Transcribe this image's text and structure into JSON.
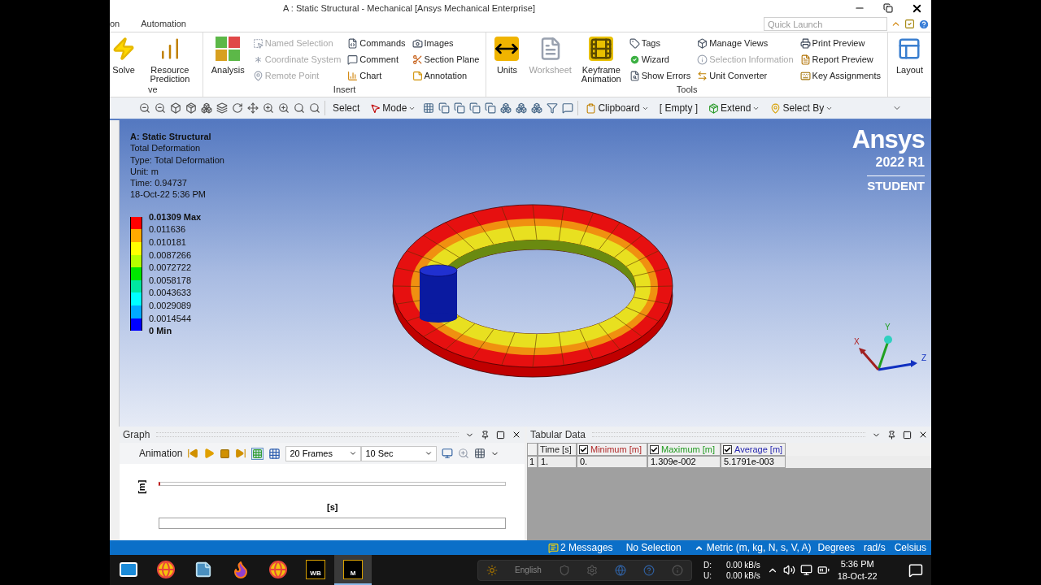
{
  "window": {
    "title": "A : Static Structural - Mechanical [Ansys Mechanical Enterprise]"
  },
  "menu_tabs": [
    "on",
    "Automation"
  ],
  "quick_launch": {
    "placeholder": "Quick Launch"
  },
  "ribbon": {
    "groups": [
      {
        "label": "ve",
        "items": [
          {
            "kind": "large",
            "label": "Solve",
            "disabled": false
          },
          {
            "kind": "large",
            "label": "Resource Prediction",
            "disabled": false
          }
        ]
      },
      {
        "label": "Insert",
        "items": [
          {
            "kind": "large",
            "label": "Analysis",
            "disabled": false
          },
          {
            "kind": "column",
            "items": [
              {
                "label": "Named Selection",
                "disabled": true
              },
              {
                "label": "Coordinate System",
                "disabled": true
              },
              {
                "label": "Remote Point",
                "disabled": true
              }
            ]
          },
          {
            "kind": "column",
            "items": [
              {
                "label": "Commands",
                "disabled": false
              },
              {
                "label": "Comment",
                "disabled": false
              },
              {
                "label": "Chart",
                "disabled": false
              }
            ]
          },
          {
            "kind": "column",
            "items": [
              {
                "label": "Images",
                "disabled": false
              },
              {
                "label": "Section Plane",
                "disabled": false
              },
              {
                "label": "Annotation",
                "disabled": false
              }
            ]
          }
        ]
      },
      {
        "label": "Tools",
        "items": [
          {
            "kind": "large",
            "label": "Units",
            "disabled": false
          },
          {
            "kind": "large",
            "label": "Worksheet",
            "disabled": true
          },
          {
            "kind": "large",
            "label": "Keyframe Animation",
            "disabled": false
          },
          {
            "kind": "column",
            "items": [
              {
                "label": "Tags",
                "disabled": false
              },
              {
                "label": "Wizard",
                "disabled": false
              },
              {
                "label": "Show Errors",
                "disabled": false
              }
            ]
          },
          {
            "kind": "column",
            "items": [
              {
                "label": "Manage Views",
                "disabled": false
              },
              {
                "label": "Selection Information",
                "disabled": true
              },
              {
                "label": "Unit Converter",
                "disabled": false
              }
            ]
          },
          {
            "kind": "column",
            "items": [
              {
                "label": "Print Preview",
                "disabled": false
              },
              {
                "label": "Report Preview",
                "disabled": false
              },
              {
                "label": "Key Assignments",
                "disabled": false
              }
            ]
          }
        ]
      },
      {
        "items": [
          {
            "kind": "large",
            "label": "Layout",
            "disabled": false
          }
        ]
      }
    ]
  },
  "toolbar": {
    "items": [
      {
        "kind": "text",
        "label": "Select"
      },
      {
        "kind": "menu",
        "label": "Mode"
      },
      {
        "kind": "menu",
        "label": "Clipboard"
      },
      {
        "kind": "text",
        "label": "[ Empty ]"
      },
      {
        "kind": "menu",
        "label": "Extend"
      },
      {
        "kind": "menu",
        "label": "Select By"
      }
    ]
  },
  "viewport": {
    "info": {
      "title": "A: Static Structural",
      "lines": [
        "Total Deformation",
        "Type: Total Deformation",
        "Unit: m",
        "Time: 0.94737",
        "18-Oct-22 5:36 PM"
      ]
    },
    "legend": {
      "labels": [
        "0.01309 Max",
        "0.011636",
        "0.010181",
        "0.0087266",
        "0.0072722",
        "0.0058178",
        "0.0043633",
        "0.0029089",
        "0.0014544",
        "0 Min"
      ],
      "bands": [
        {
          "color": "#ff0000"
        },
        {
          "color": "#ffaa00"
        },
        {
          "color": "#ffff00"
        },
        {
          "color": "#b4ff00"
        },
        {
          "color": "#00e600"
        },
        {
          "color": "#00e6a0"
        },
        {
          "color": "#00ffff"
        },
        {
          "color": "#00aaff"
        },
        {
          "color": "#0000ff"
        }
      ]
    },
    "logo": {
      "name": "Ansys",
      "version": "2022 R1",
      "edition": "STUDENT"
    },
    "triad": [
      "X",
      "Y",
      "Z"
    ]
  },
  "graph": {
    "title": "Graph",
    "animation_label": "Animation",
    "frames": "20 Frames",
    "duration": "10 Sec",
    "y_label": "[m]",
    "x_label": "[s]"
  },
  "tabular": {
    "title": "Tabular Data",
    "columns": [
      {
        "label": "Time [s]"
      },
      {
        "label": "Minimum [m]",
        "checked": true,
        "color": "#b02828"
      },
      {
        "label": "Maximum [m]",
        "checked": true,
        "color": "#1e9a1e"
      },
      {
        "label": "Average [m]",
        "checked": true,
        "color": "#2828b0"
      }
    ],
    "rows": [
      {
        "index": "1",
        "cells": [
          "1.",
          "0.",
          "1.309e-002",
          "5.1791e-003"
        ]
      }
    ]
  },
  "status_bar": {
    "messages": "2 Messages",
    "selection": "No Selection",
    "units": "Metric (m, kg, N, s, V, A)",
    "angle": "Degrees",
    "angular_velocity": "rad/s",
    "temperature": "Celsius"
  },
  "taskbar": {
    "apps": [
      {
        "kind": "mail",
        "selected": false
      },
      {
        "kind": "chrome",
        "selected": false
      },
      {
        "kind": "notes",
        "selected": false
      },
      {
        "kind": "firefox",
        "selected": false
      },
      {
        "kind": "chrome",
        "selected": false
      },
      {
        "kind": "workbench",
        "label": "WB",
        "selected": false
      },
      {
        "kind": "mechanical",
        "label": "M",
        "selected": true
      }
    ],
    "language": "English",
    "network": {
      "down_label": "D:",
      "up_label": "U:",
      "down": "0.00 kB/s",
      "up": "0.00 kB/s"
    },
    "clock": {
      "time": "5:36 PM",
      "date": "18-Oct-22"
    }
  }
}
